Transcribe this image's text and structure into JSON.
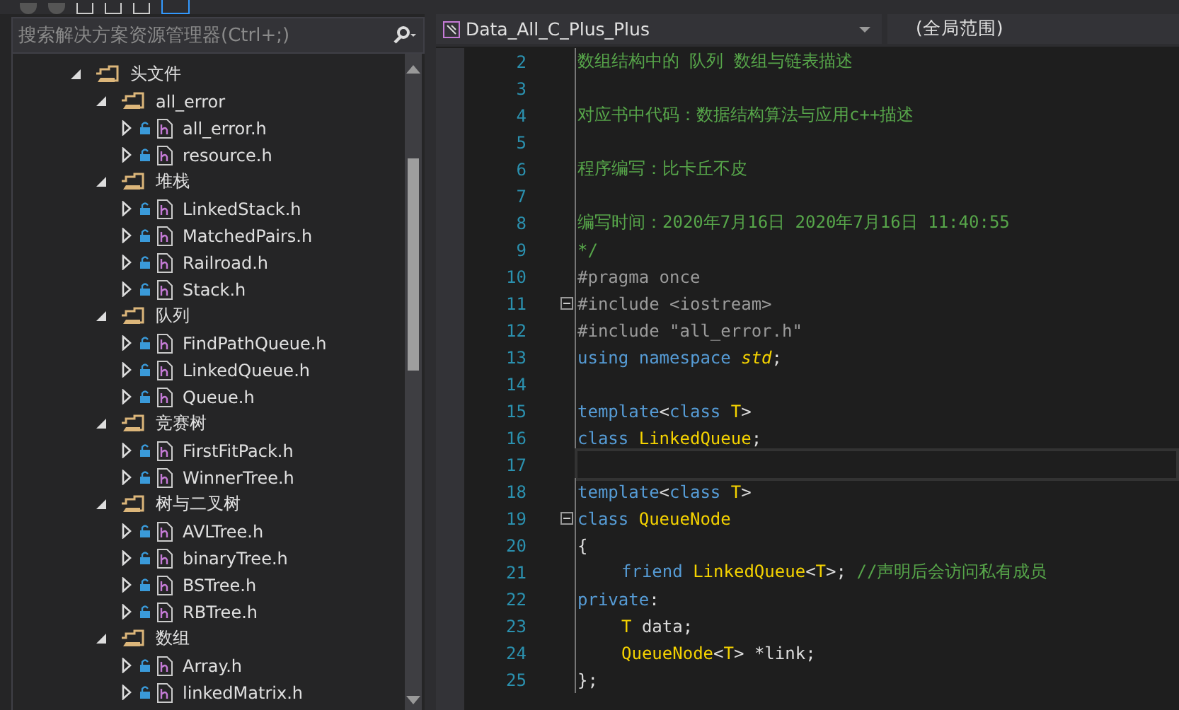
{
  "explorer": {
    "search": {
      "placeholder": "搜索解决方案资源管理器(Ctrl+;)"
    },
    "tree": [
      {
        "label": "头文件",
        "kind": "folder",
        "expanded": true,
        "children": [
          {
            "label": "all_error",
            "kind": "folder",
            "expanded": true,
            "children": [
              {
                "label": "all_error.h",
                "kind": "file",
                "expanded": false
              },
              {
                "label": "resource.h",
                "kind": "file",
                "expanded": false
              }
            ]
          },
          {
            "label": "堆栈",
            "kind": "folder",
            "expanded": true,
            "children": [
              {
                "label": "LinkedStack.h",
                "kind": "file",
                "expanded": false
              },
              {
                "label": "MatchedPairs.h",
                "kind": "file",
                "expanded": false
              },
              {
                "label": "Railroad.h",
                "kind": "file",
                "expanded": false
              },
              {
                "label": "Stack.h",
                "kind": "file",
                "expanded": false
              }
            ]
          },
          {
            "label": "队列",
            "kind": "folder",
            "expanded": true,
            "children": [
              {
                "label": "FindPathQueue.h",
                "kind": "file",
                "expanded": false
              },
              {
                "label": "LinkedQueue.h",
                "kind": "file",
                "expanded": false
              },
              {
                "label": "Queue.h",
                "kind": "file",
                "expanded": false
              }
            ]
          },
          {
            "label": "竞赛树",
            "kind": "folder",
            "expanded": true,
            "children": [
              {
                "label": "FirstFitPack.h",
                "kind": "file",
                "expanded": false
              },
              {
                "label": "WinnerTree.h",
                "kind": "file",
                "expanded": false
              }
            ]
          },
          {
            "label": "树与二叉树",
            "kind": "folder",
            "expanded": true,
            "children": [
              {
                "label": "AVLTree.h",
                "kind": "file",
                "expanded": false
              },
              {
                "label": "binaryTree.h",
                "kind": "file",
                "expanded": false
              },
              {
                "label": "BSTree.h",
                "kind": "file",
                "expanded": false
              },
              {
                "label": "RBTree.h",
                "kind": "file",
                "expanded": false
              }
            ]
          },
          {
            "label": "数组",
            "kind": "folder",
            "expanded": true,
            "children": [
              {
                "label": "Array.h",
                "kind": "file",
                "expanded": false
              },
              {
                "label": "linkedMatrix.h",
                "kind": "file",
                "expanded": false
              }
            ]
          }
        ]
      }
    ]
  },
  "editor": {
    "project_dropdown": "Data_All_C_Plus_Plus",
    "scope_dropdown": "(全局范围)",
    "lines": [
      {
        "number": "2",
        "tokens": [
          {
            "kind": "comment",
            "text": "数组结构中的 队列 数组与链表描述"
          }
        ]
      },
      {
        "number": "3"
      },
      {
        "number": "4",
        "tokens": [
          {
            "kind": "comment",
            "text": "对应书中代码：数据结构算法与应用c++描述"
          }
        ]
      },
      {
        "number": "5"
      },
      {
        "number": "6",
        "tokens": [
          {
            "kind": "comment",
            "text": "程序编写：比卡丘不皮"
          }
        ]
      },
      {
        "number": "7"
      },
      {
        "number": "8",
        "tokens": [
          {
            "kind": "comment",
            "text": "编写时间：2020年7月16日 2020年7月16日 11:40:55"
          }
        ]
      },
      {
        "number": "9",
        "tokens": [
          {
            "kind": "comment",
            "text": "*/"
          }
        ]
      },
      {
        "number": "10",
        "tokens": [
          {
            "kind": "pre",
            "text": "#pragma once"
          }
        ]
      },
      {
        "number": "11",
        "foldable": true,
        "tokens": [
          {
            "kind": "pre",
            "text": "#include <iostream>"
          }
        ]
      },
      {
        "number": "12",
        "tokens": [
          {
            "kind": "pre",
            "text": "#include \"all_error.h\""
          }
        ]
      },
      {
        "number": "13",
        "tokens": [
          {
            "kind": "keyword",
            "text": "using namespace "
          },
          {
            "kind": "italic",
            "text": "std"
          },
          {
            "kind": "plain",
            "text": ";"
          }
        ]
      },
      {
        "number": "14"
      },
      {
        "number": "15",
        "tokens": [
          {
            "kind": "keyword",
            "text": "template"
          },
          {
            "kind": "plain",
            "text": "<"
          },
          {
            "kind": "keyword",
            "text": "class "
          },
          {
            "kind": "type",
            "text": "T"
          },
          {
            "kind": "plain",
            "text": ">"
          }
        ]
      },
      {
        "number": "16",
        "tokens": [
          {
            "kind": "keyword",
            "text": "class "
          },
          {
            "kind": "type",
            "text": "LinkedQueue"
          },
          {
            "kind": "plain",
            "text": ";"
          }
        ]
      },
      {
        "number": "17",
        "current": true
      },
      {
        "number": "18",
        "tokens": [
          {
            "kind": "keyword",
            "text": "template"
          },
          {
            "kind": "plain",
            "text": "<"
          },
          {
            "kind": "keyword",
            "text": "class "
          },
          {
            "kind": "type",
            "text": "T"
          },
          {
            "kind": "plain",
            "text": ">"
          }
        ]
      },
      {
        "number": "19",
        "foldable": true,
        "tokens": [
          {
            "kind": "keyword",
            "text": "class "
          },
          {
            "kind": "type",
            "text": "QueueNode"
          }
        ]
      },
      {
        "number": "20",
        "tokens": [
          {
            "kind": "plain",
            "text": "{"
          }
        ]
      },
      {
        "number": "21",
        "indented": true,
        "tokens": [
          {
            "kind": "keyword",
            "text": "friend "
          },
          {
            "kind": "type",
            "text": "LinkedQueue"
          },
          {
            "kind": "plain",
            "text": "<"
          },
          {
            "kind": "type",
            "text": "T"
          },
          {
            "kind": "plain",
            "text": ">; "
          },
          {
            "kind": "comment",
            "text": "//声明后会访问私有成员"
          }
        ]
      },
      {
        "number": "22",
        "tokens": [
          {
            "kind": "keyword",
            "text": "private"
          },
          {
            "kind": "plain",
            "text": ":"
          }
        ]
      },
      {
        "number": "23",
        "indented": true,
        "tokens": [
          {
            "kind": "type",
            "text": "T"
          },
          {
            "kind": "plain",
            "text": " data;"
          }
        ]
      },
      {
        "number": "24",
        "indented": true,
        "tokens": [
          {
            "kind": "type",
            "text": "QueueNode"
          },
          {
            "kind": "plain",
            "text": "<"
          },
          {
            "kind": "type",
            "text": "T"
          },
          {
            "kind": "plain",
            "text": "> *link;"
          }
        ]
      },
      {
        "number": "25",
        "tokens": [
          {
            "kind": "plain",
            "text": "};"
          }
        ]
      }
    ]
  }
}
